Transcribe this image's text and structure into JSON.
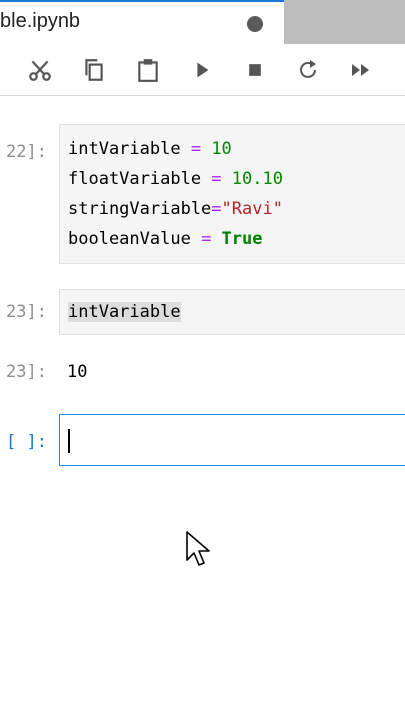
{
  "tab": {
    "title": "ble.ipynb"
  },
  "toolbar": {
    "buttons": [
      {
        "icon": "scissors-icon"
      },
      {
        "icon": "copy-icon"
      },
      {
        "icon": "paste-icon"
      },
      {
        "icon": "run-icon"
      },
      {
        "icon": "stop-icon"
      },
      {
        "icon": "restart-icon"
      },
      {
        "icon": "fast-forward-icon"
      }
    ]
  },
  "cells": {
    "cell1": {
      "prompt": "22]:",
      "lines": [
        {
          "name": "intVariable",
          "op": " = ",
          "value": "10"
        },
        {
          "name": "floatVariable",
          "op": " = ",
          "value": "10.10"
        },
        {
          "name": "stringVariable",
          "op": "=",
          "value": "\"Ravi\""
        },
        {
          "name": "booleanValue",
          "op": " = ",
          "value": "True"
        }
      ]
    },
    "cell2": {
      "prompt": "23]:",
      "code": "intVariable"
    },
    "output2": {
      "prompt": "23]:",
      "text": "10"
    },
    "cell3": {
      "prompt": "[ ]:"
    }
  },
  "colors": {
    "accent": "#1976d2",
    "operator": "#aa22ff",
    "number": "#008800",
    "string": "#ba2121",
    "keyword": "#008000"
  }
}
